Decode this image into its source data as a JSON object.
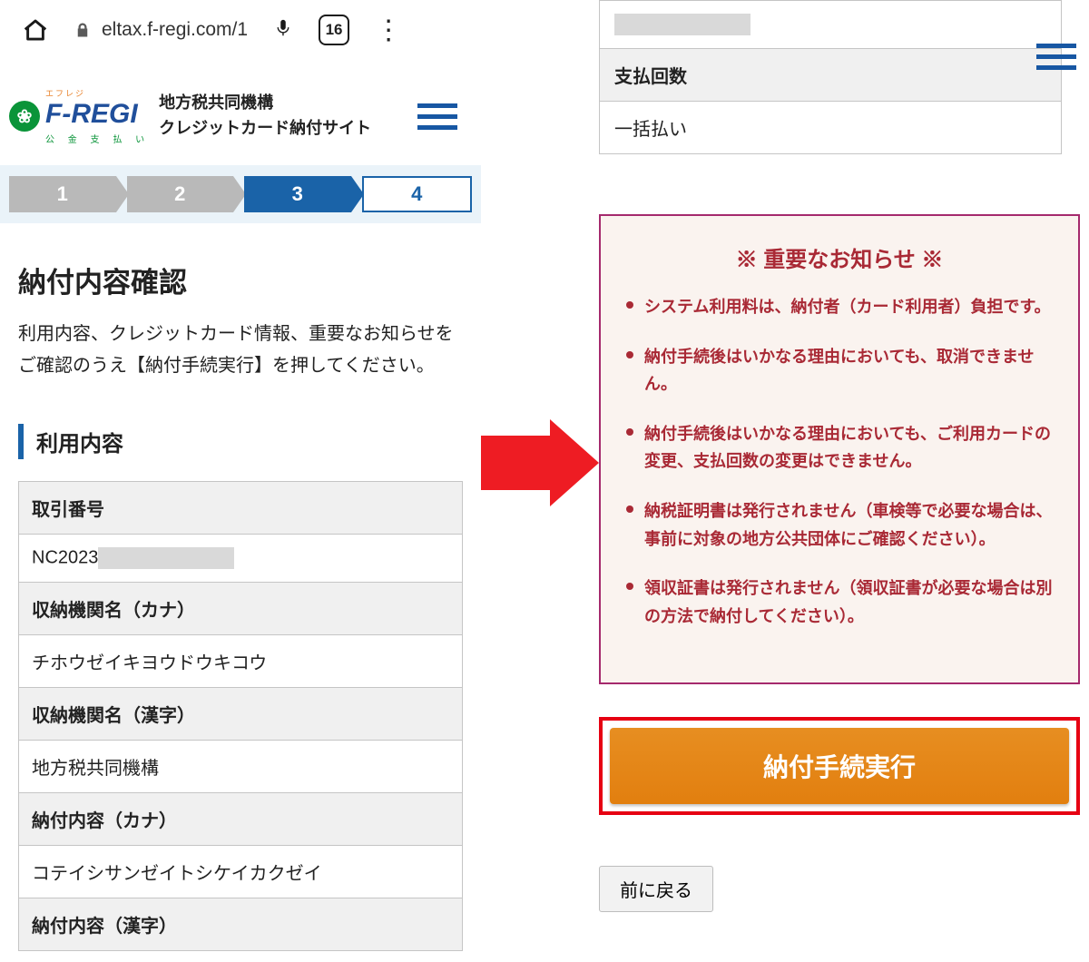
{
  "browser": {
    "url": "eltax.f-regi.com/1",
    "tab_count": "16"
  },
  "header": {
    "brand_main": "F-REGI",
    "brand_tiny": "エフレジ",
    "brand_sub": "公 金 支 払 い",
    "site_title_line1": "地方税共同機構",
    "site_title_line2": "クレジットカード納付サイト"
  },
  "steps": {
    "s1": "1",
    "s2": "2",
    "s3": "3",
    "s4": "4"
  },
  "page": {
    "title": "納付内容確認",
    "desc": "利用内容、クレジットカード情報、重要なお知らせをご確認のうえ【納付手続実行】を押してください。",
    "section_title": "利用内容"
  },
  "table": {
    "row1_th": "取引番号",
    "row1_td_prefix": "NC2023",
    "row2_th": "収納機関名（カナ）",
    "row2_td": "チホウゼイキヨウドウキコウ",
    "row3_th": "収納機関名（漢字）",
    "row3_td": "地方税共同機構",
    "row4_th": "納付内容（カナ）",
    "row4_td": "コテイシサンゼイトシケイカクゼイ",
    "row5_th": "納付内容（漢字）"
  },
  "right_table": {
    "th_payments": "支払回数",
    "td_payments": "一括払い"
  },
  "notice": {
    "title": "※ 重要なお知らせ ※",
    "li1": "システム利用料は、納付者（カード利用者）負担です。",
    "li2": "納付手続後はいかなる理由においても、取消できません。",
    "li3": "納付手続後はいかなる理由においても、ご利用カードの変更、支払回数の変更はできません。",
    "li4": "納税証明書は発行されません（車検等で必要な場合は、事前に対象の地方公共団体にご確認ください）。",
    "li5": "領収証書は発行されません（領収証書が必要な場合は別の方法で納付してください）。"
  },
  "buttons": {
    "execute": "納付手続実行",
    "back": "前に戻る"
  }
}
